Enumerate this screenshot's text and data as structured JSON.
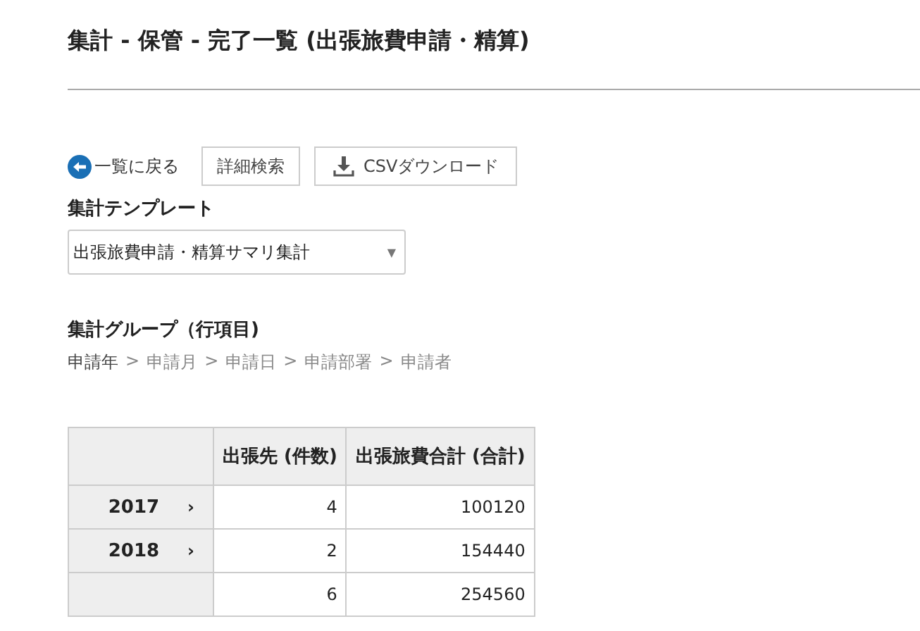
{
  "title": "集計 - 保管 - 完了一覧 (出張旅費申請・精算)",
  "toolbar": {
    "back_link": "一覧に戻る",
    "detail_search": "詳細検索",
    "csv_download": "CSVダウンロード"
  },
  "template": {
    "label": "集計テンプレート",
    "value": "出張旅費申請・精算サマリ集計",
    "caret": "▼"
  },
  "group": {
    "label": "集計グループ（行項目)",
    "path": [
      {
        "kind": "item",
        "text": "申請年",
        "selected": true
      },
      {
        "kind": "separator",
        "text": ">"
      },
      {
        "kind": "item",
        "text": "申請月",
        "selected": false
      },
      {
        "kind": "separator",
        "text": ">"
      },
      {
        "kind": "item",
        "text": "申請日",
        "selected": false
      },
      {
        "kind": "separator",
        "text": ">"
      },
      {
        "kind": "item",
        "text": "申請部署",
        "selected": false
      },
      {
        "kind": "separator",
        "text": ">"
      },
      {
        "kind": "item",
        "text": "申請者",
        "selected": false
      }
    ]
  },
  "table": {
    "columns": [
      "出張先 (件数)",
      "出張旅費合計 (合計)"
    ],
    "rows": [
      {
        "label": "2017",
        "expander": "›",
        "values": [
          "4",
          "100120"
        ]
      },
      {
        "label": "2018",
        "expander": "›",
        "values": [
          "2",
          "154440"
        ]
      },
      {
        "values": [
          "6",
          "254560"
        ]
      }
    ]
  }
}
